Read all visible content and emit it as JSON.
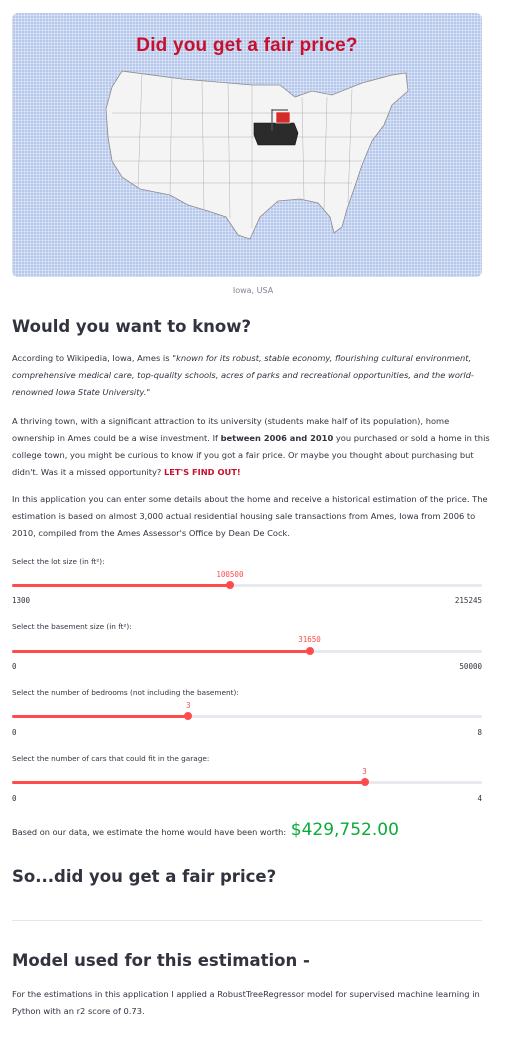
{
  "hero": {
    "title": "Did you get a fair price?",
    "sign_text": "FOR SALE",
    "caption": "Iowa, USA"
  },
  "section1": {
    "heading": "Would you want to know?",
    "p1_lead": "According to Wikipedia, Iowa, Ames is ",
    "p1_quote": "\"known for its robust, stable economy, flourishing cultural environment, comprehensive medical care, top-quality schools, acres of parks and recreational opportunities, and the world-renowned Iowa State University.\"",
    "p2_a": "A thriving town, with a significant attraction to its university (students make half of its population), home ownership in Ames could be a wise investment. If ",
    "p2_bold": "between 2006 and 2010",
    "p2_b": " you purchased or sold a home in this college town, you might be curious to know if you got a fair price. Or maybe you thought about purchasing but didn't. Was it a missed opportunity? ",
    "p2_cta": "LET'S FIND OUT!",
    "p3": "In this application you can enter some details about the home and receive a historical estimation of the price. The estimation is based on almost 3,000 actual residential housing sale transactions from Ames, Iowa from 2006 to 2010, compiled from the Ames Assessor's Office by Dean De Cock."
  },
  "sliders": [
    {
      "label": "Select the lot size (in ft²):",
      "min": 1300,
      "max": 215245,
      "value": 100500,
      "min_label": "1300",
      "max_label": "215245",
      "value_label": "100500"
    },
    {
      "label": "Select the basement size (in ft²):",
      "min": 0,
      "max": 50000,
      "value": 31650,
      "min_label": "0",
      "max_label": "50000",
      "value_label": "31650"
    },
    {
      "label": "Select the number of bedrooms (not including the basement):",
      "min": 0,
      "max": 8,
      "value": 3,
      "min_label": "0",
      "max_label": "8",
      "value_label": "3"
    },
    {
      "label": "Select the number of cars that could fit in the garage:",
      "min": 0,
      "max": 4,
      "value": 3,
      "min_label": "0",
      "max_label": "4",
      "value_label": "3"
    }
  ],
  "estimate": {
    "text": "Based on our data, we estimate the home would have been worth:",
    "price": "$429,752.00",
    "price_color": "#09ab3b"
  },
  "section2": {
    "heading": "So...did you get a fair price?"
  },
  "section3": {
    "heading": "Model used for this estimation -",
    "text": "For the estimations in this application I applied a RobustTreeRegressor model for supervised machine learning in Python with an r2 score of 0.73."
  },
  "colors": {
    "accent": "#ff4b4b",
    "title_red": "#c8102e",
    "map_bg": "#b6c8ec",
    "highlight_state": "#2b2b2b"
  }
}
